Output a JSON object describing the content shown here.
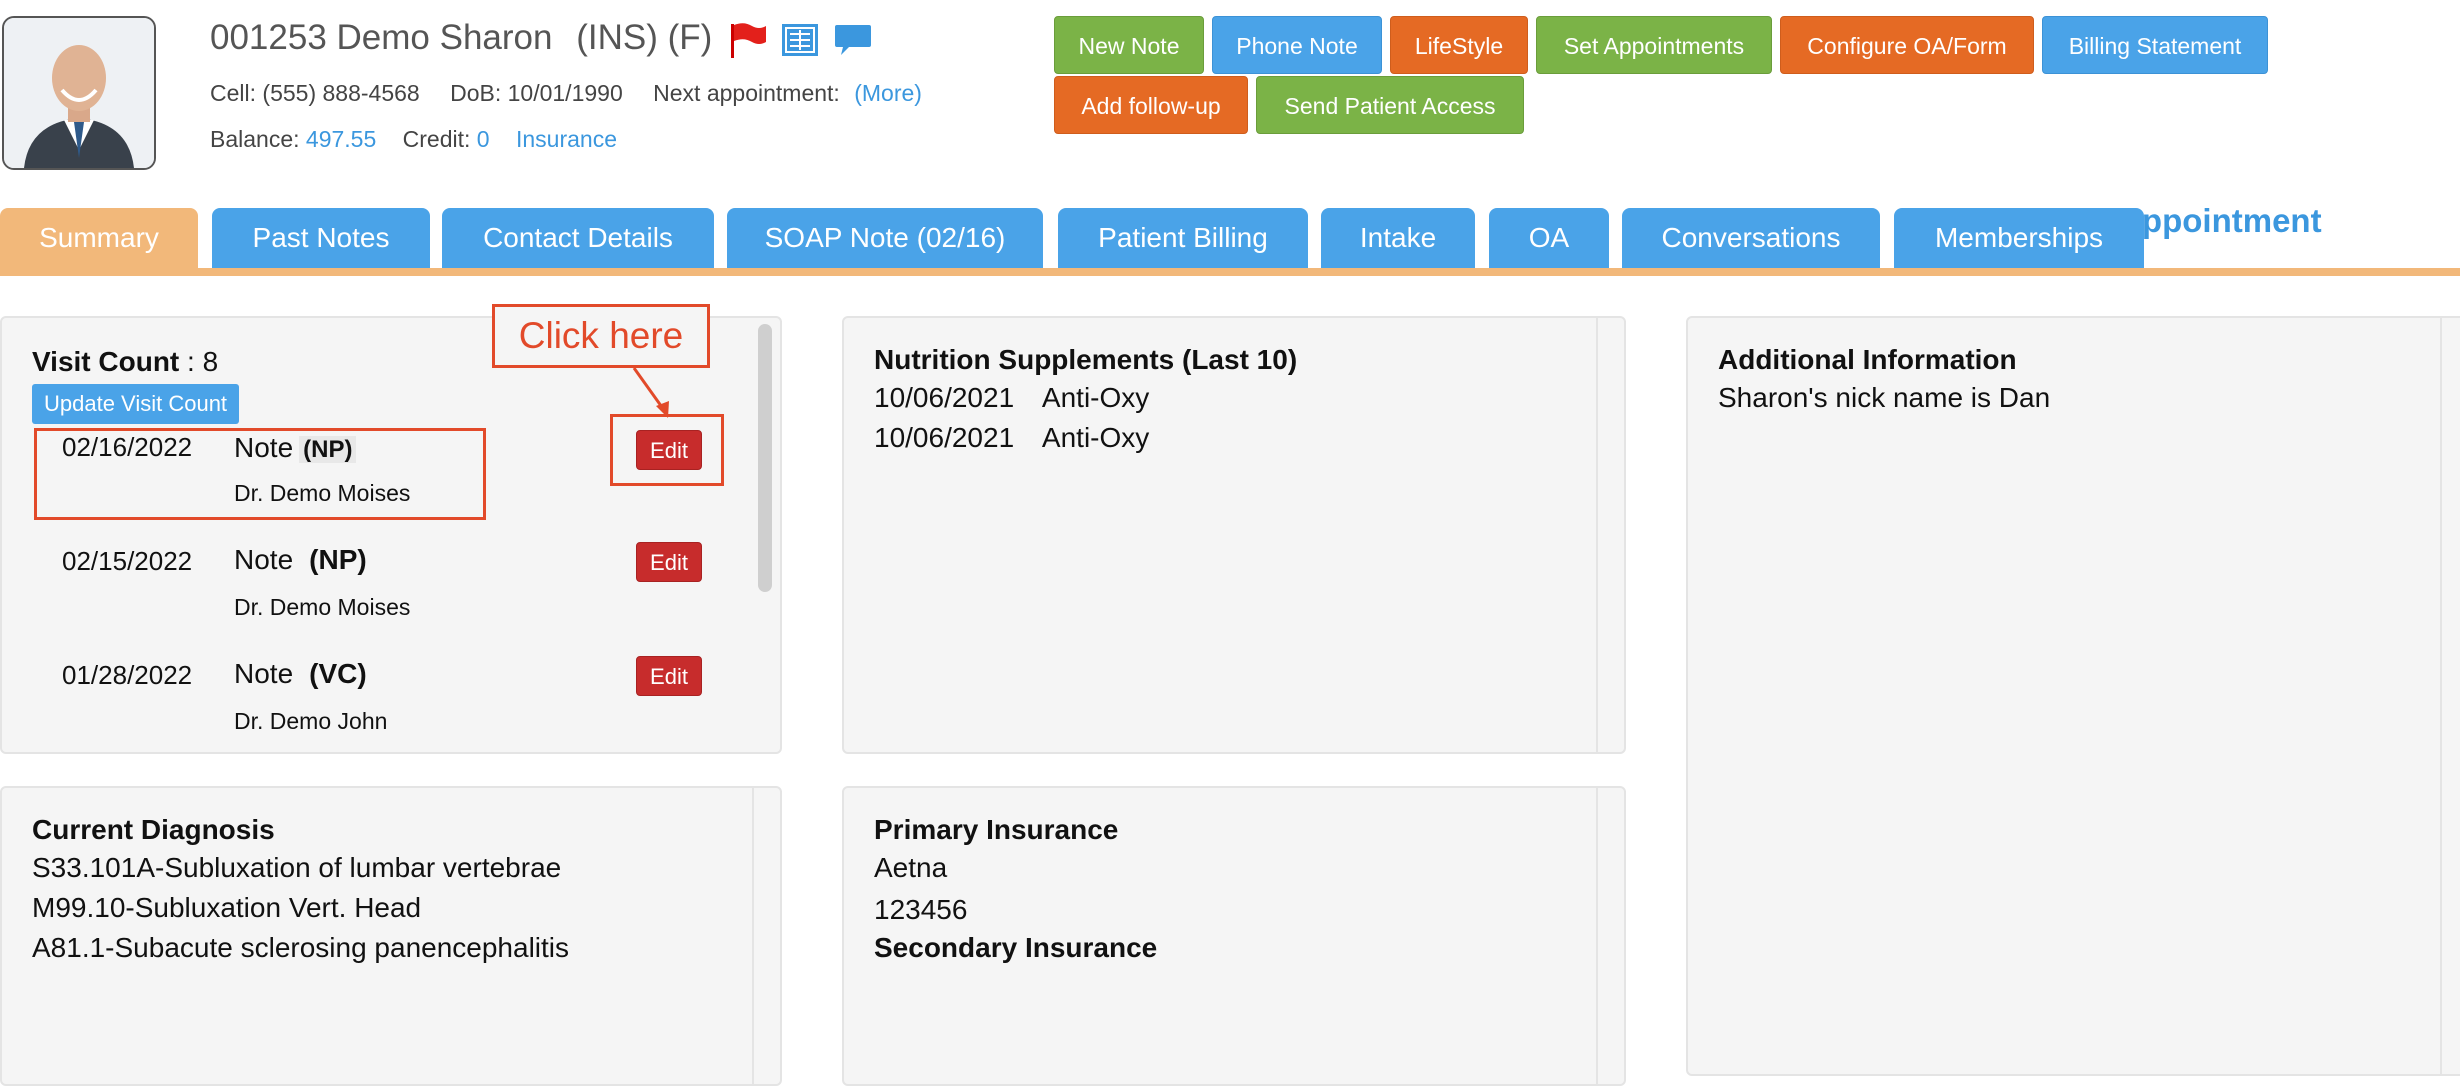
{
  "patient": {
    "id_name": "001253 Demo Sharon",
    "ins_gender": "(INS) (F)",
    "cell_label": "Cell:",
    "cell": "(555) 888-4568",
    "dob_label": "DoB:",
    "dob": "10/01/1990",
    "next_appt_label": "Next appointment:",
    "more_link": "(More)",
    "balance_label": "Balance:",
    "balance": "497.55",
    "credit_label": "Credit:",
    "credit": "0",
    "insurance_link": "Insurance"
  },
  "header_icons": [
    "flag-icon",
    "document-icon",
    "chat-bubble-icon"
  ],
  "actions": {
    "new_note": "New Note",
    "phone_note": "Phone Note",
    "lifestyle": "LifeStyle",
    "set_appointments": "Set Appointments",
    "configure_oa": "Configure OA/Form",
    "billing_statement": "Billing Statement",
    "add_followup": "Add follow-up",
    "send_patient_access": "Send Patient Access"
  },
  "colors": {
    "green": "#7bb347",
    "blue": "#4aa3e8",
    "orange": "#e56a24",
    "edit_red": "#c72c2c",
    "active_tab": "#f2b87a",
    "annotation": "#e24a2a",
    "link": "#3b97de"
  },
  "tabs": {
    "summary": "Summary",
    "past_notes": "Past Notes",
    "contact_details": "Contact Details",
    "soap_note": "SOAP Note (02/16)",
    "patient_billing": "Patient Billing",
    "intake": "Intake",
    "oa": "OA",
    "conversations": "Conversations",
    "memberships": "Memberships",
    "overflow_text": "d Appointment",
    "active": "Summary"
  },
  "visits": {
    "count_label": "Visit Count",
    "count_sep": " : ",
    "count": "8",
    "update_button": "Update Visit Count",
    "edit_label": "Edit",
    "items": [
      {
        "date": "02/16/2022",
        "note": "Note",
        "type": "(NP)",
        "doctor": "Dr. Demo Moises"
      },
      {
        "date": "02/15/2022",
        "note": "Note",
        "type": "(NP)",
        "doctor": "Dr. Demo Moises"
      },
      {
        "date": "01/28/2022",
        "note": "Note",
        "type": "(VC)",
        "doctor": "Dr. Demo John"
      }
    ]
  },
  "annotation": {
    "click_here": "Click here"
  },
  "nutrition": {
    "title": "Nutrition Supplements (Last 10)",
    "items": [
      {
        "date": "10/06/2021",
        "name": "Anti-Oxy"
      },
      {
        "date": "10/06/2021",
        "name": "Anti-Oxy"
      }
    ]
  },
  "additional": {
    "title": "Additional Information",
    "text": "Sharon's nick name is Dan"
  },
  "diagnosis": {
    "title": "Current Diagnosis",
    "items": [
      "S33.101A-Subluxation of lumbar vertebrae",
      "M99.10-Subluxation Vert. Head",
      "A81.1-Subacute sclerosing panencephalitis"
    ]
  },
  "insurance": {
    "primary_title": "Primary Insurance",
    "primary_name": "Aetna",
    "primary_id": "123456",
    "secondary_title": "Secondary Insurance"
  }
}
